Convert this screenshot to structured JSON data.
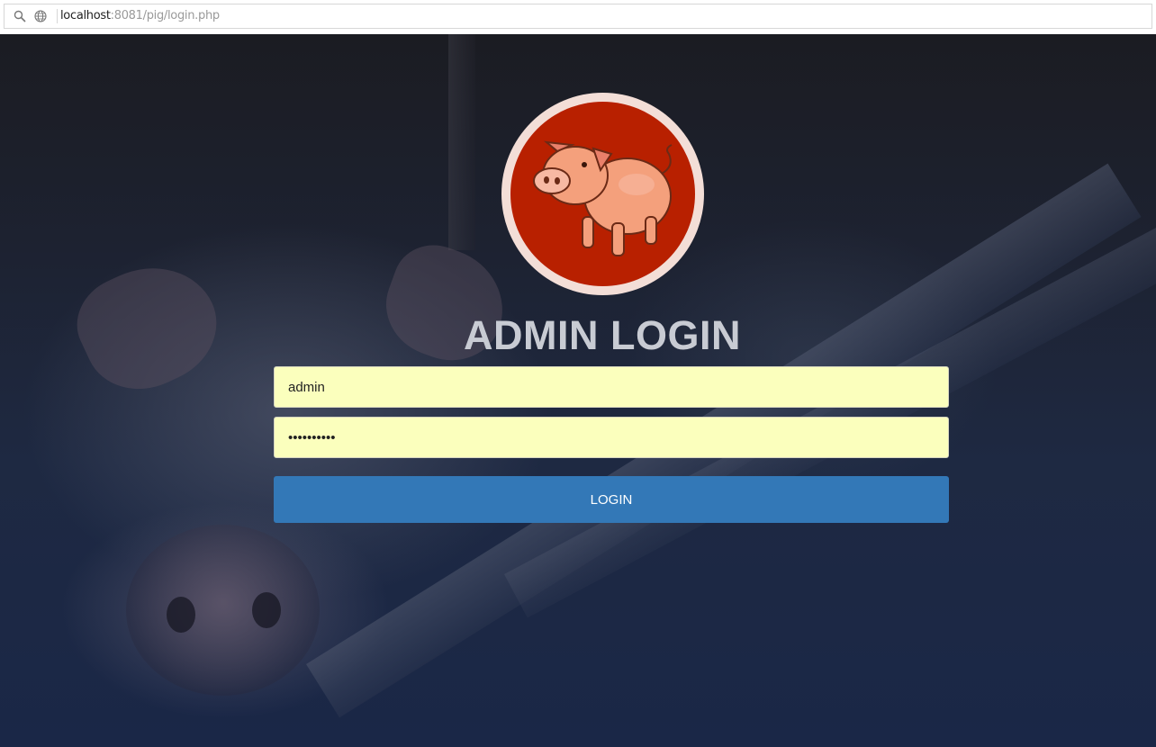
{
  "browser": {
    "url_host": "localhost",
    "url_rest": ":8081/pig/login.php"
  },
  "login": {
    "title": "ADMIN LOGIN",
    "username_value": "admin",
    "password_value": "••••••••••",
    "button_label": "LOGIN"
  },
  "colors": {
    "logo_red": "#b82000",
    "logo_ring": "#f3ded7",
    "button_blue": "#3378b7",
    "input_fill": "#fbffbd",
    "title_text": "#c8cbd3"
  },
  "icons": {
    "address_left": "magnifier-icon",
    "address_right": "globe-icon",
    "logo": "pig-logo-icon"
  }
}
